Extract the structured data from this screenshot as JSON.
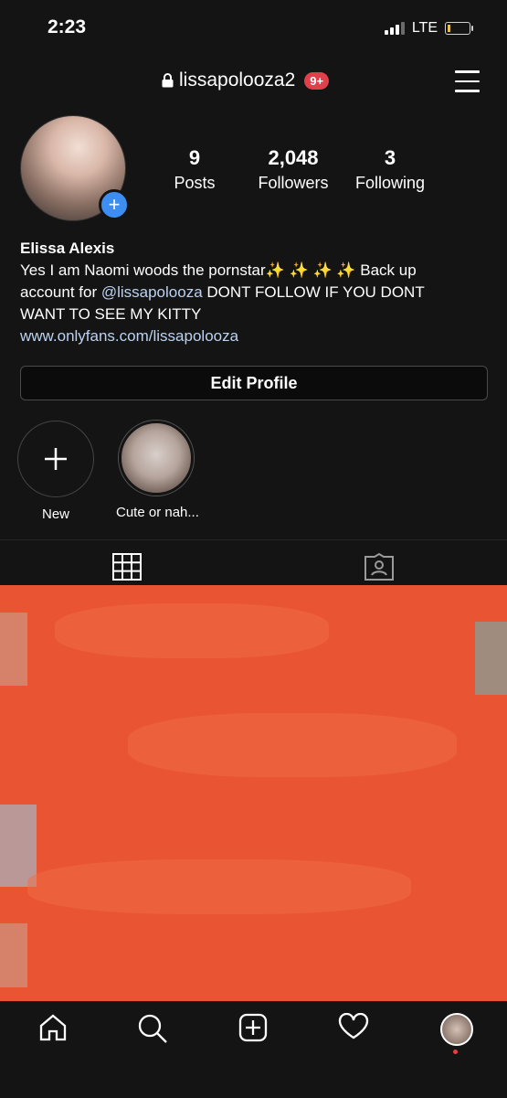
{
  "status_bar": {
    "time": "2:23",
    "network": "LTE"
  },
  "header": {
    "username": "lissapolooza2",
    "notification_badge": "9+"
  },
  "profile": {
    "stats": [
      {
        "value": "9",
        "label": "Posts"
      },
      {
        "value": "2,048",
        "label": "Followers"
      },
      {
        "value": "3",
        "label": "Following"
      }
    ],
    "name": "Elissa Alexis",
    "bio_line1": "Yes I am Naomi woods the pornstar✨ ✨ ✨ ✨  Back up",
    "bio_line2_prefix": "account for ",
    "bio_mention": "@lissapolooza",
    "bio_line2_suffix": " DONT FOLLOW IF YOU DONT",
    "bio_line3": "WANT TO SEE MY KITTY",
    "website": "www.onlyfans.com/lissapolooza",
    "edit_button": "Edit Profile"
  },
  "highlights": [
    {
      "label": "New",
      "icon": "plus-icon"
    },
    {
      "label": "Cute or nah..."
    }
  ],
  "tabs": [
    {
      "icon": "grid-icon"
    },
    {
      "icon": "tagged-icon"
    }
  ],
  "bottom_nav": [
    "home-icon",
    "search-icon",
    "new-post-icon",
    "activity-icon",
    "profile-avatar"
  ],
  "colors": {
    "background": "#141414",
    "accent": "#3d8ef0",
    "badge": "#e0404a",
    "redaction": "#e95433"
  }
}
